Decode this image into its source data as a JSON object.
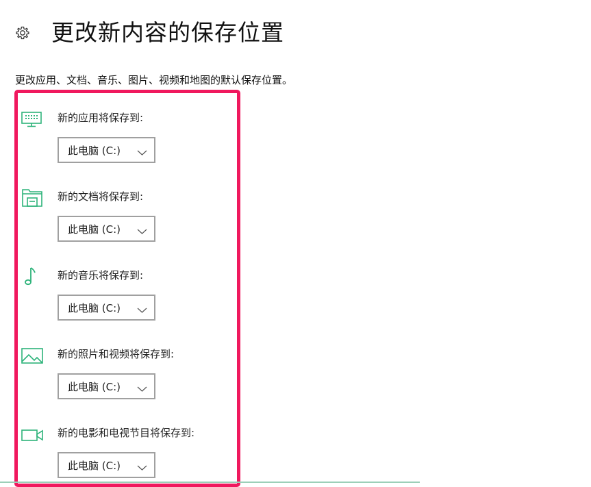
{
  "header": {
    "title": "更改新内容的保存位置",
    "icon": "gear-icon"
  },
  "description": "更改应用、文档、音乐、图片、视频和地图的默认保存位置。",
  "colors": {
    "accent": "#2db37a",
    "highlight_border": "#f0185e",
    "dropdown_border": "#a0a0a0"
  },
  "settings": [
    {
      "label": "新的应用将保存到:",
      "value": "此电脑 (C:)",
      "icon": "monitor-icon"
    },
    {
      "label": "新的文档将保存到:",
      "value": "此电脑 (C:)",
      "icon": "folder-icon"
    },
    {
      "label": "新的音乐将保存到:",
      "value": "此电脑 (C:)",
      "icon": "music-note-icon"
    },
    {
      "label": "新的照片和视频将保存到:",
      "value": "此电脑 (C:)",
      "icon": "picture-icon"
    },
    {
      "label": "新的电影和电视节目将保存到:",
      "value": "此电脑 (C:)",
      "icon": "video-camera-icon"
    }
  ]
}
